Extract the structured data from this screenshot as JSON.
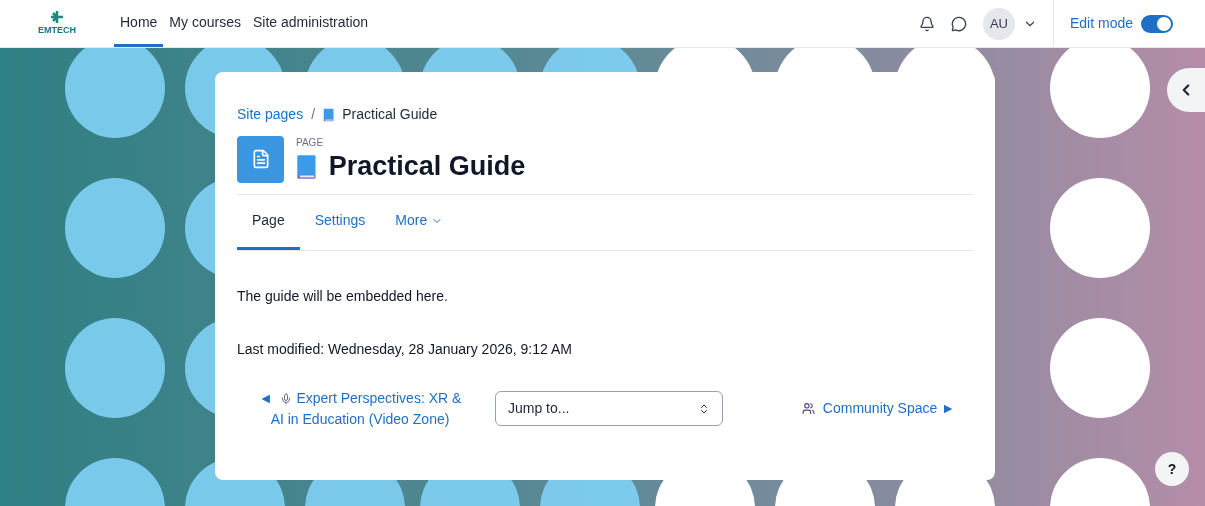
{
  "navbar": {
    "logo_text": "EMTECH",
    "items": [
      {
        "label": "Home",
        "selected": true
      },
      {
        "label": "My courses",
        "selected": false
      },
      {
        "label": "Site administration",
        "selected": false
      }
    ],
    "avatar": "AU",
    "edit_mode": {
      "label": "Edit mode",
      "on": true
    }
  },
  "breadcrumb": {
    "separator": "/",
    "items": [
      {
        "label": "Site pages",
        "kind": "link"
      },
      {
        "label": "Practical Guide",
        "kind": "current"
      }
    ]
  },
  "header": {
    "overline": "PAGE",
    "title": "Practical Guide"
  },
  "tabs": [
    {
      "label": "Page",
      "selected": true,
      "kind": "tab"
    },
    {
      "label": "Settings",
      "selected": false,
      "kind": "tab"
    },
    {
      "label": "More",
      "selected": false,
      "kind": "menu"
    }
  ],
  "content": "The guide will be embedded here.",
  "last_modified": "Last modified: Wednesday, 28 January 2026, 9:12 AM",
  "nav": {
    "prev_arrow": "◄",
    "prev": "Expert Perspectives: XR & AI in Education (Video Zone)",
    "jump": "Jump to...",
    "next": "Community Space",
    "next_arrow": "►"
  },
  "help": "?"
}
